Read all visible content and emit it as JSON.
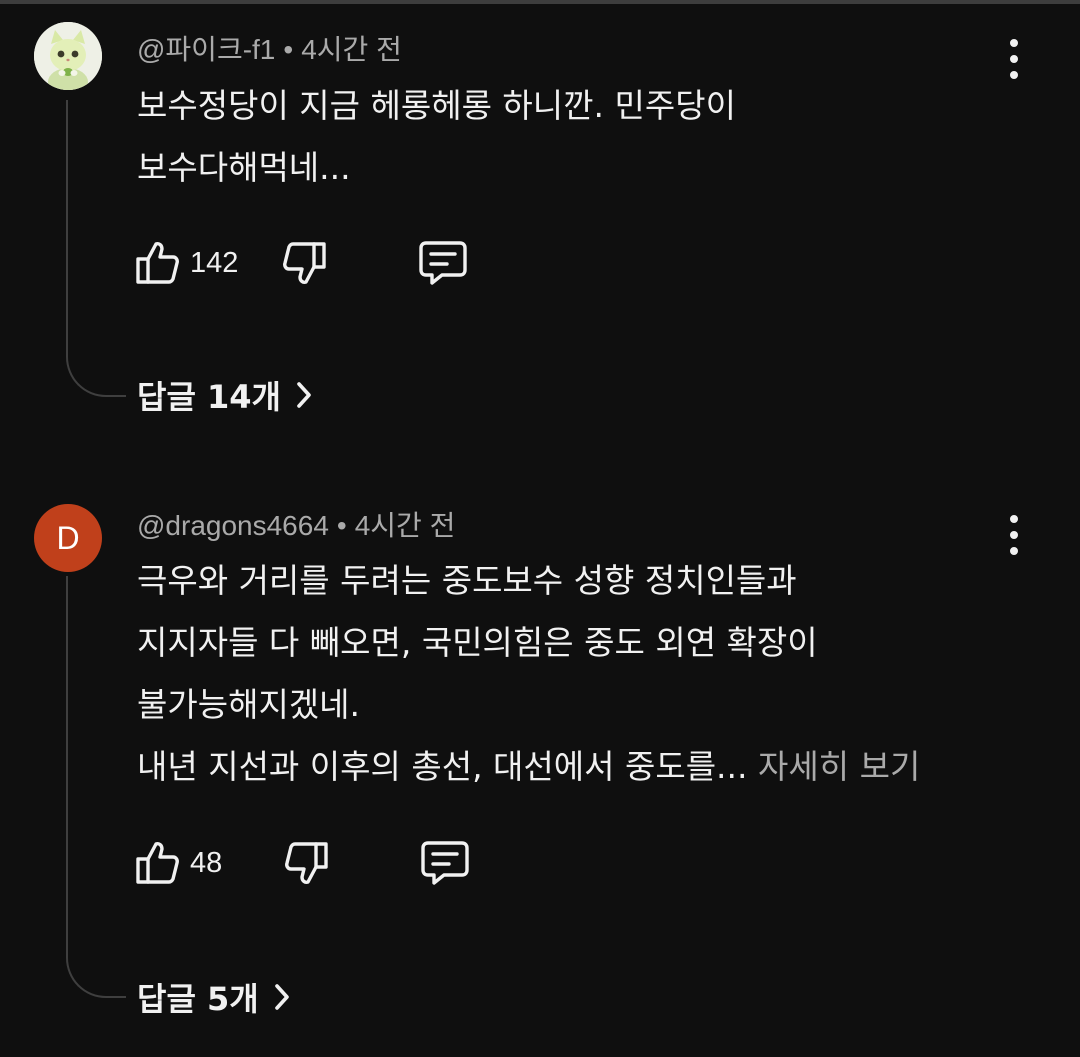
{
  "comments": [
    {
      "handle": "@파이크-f1",
      "time": "4시간 전",
      "avatar": {
        "type": "image",
        "icon": "cat-avatar-icon"
      },
      "lines": [
        "보수정당이 지금 헤롱헤롱 하니깐. 민주당이",
        "보수다해먹네..."
      ],
      "read_more": "",
      "likes": "142",
      "replies_label": "답글 14개"
    },
    {
      "handle": "@dragons4664",
      "time": "4시간 전",
      "avatar": {
        "type": "letter",
        "letter": "D",
        "color": "#c0401b"
      },
      "lines": [
        "극우와 거리를 두려는 중도보수 성향 정치인들과",
        "지지자들 다 빼오면, 국민의힘은 중도 외연 확장이",
        "불가능해지겠네.",
        "내년 지선과 이후의 총선, 대선에서 중도를..."
      ],
      "read_more": "자세히 보기",
      "likes": "48",
      "replies_label": "답글 5개"
    }
  ],
  "separator": "•",
  "colors": {
    "background": "#0f0f0f",
    "text": "#f1f1f1",
    "secondary_text": "#aaaaaa",
    "thread_line": "#3f3f3f"
  }
}
